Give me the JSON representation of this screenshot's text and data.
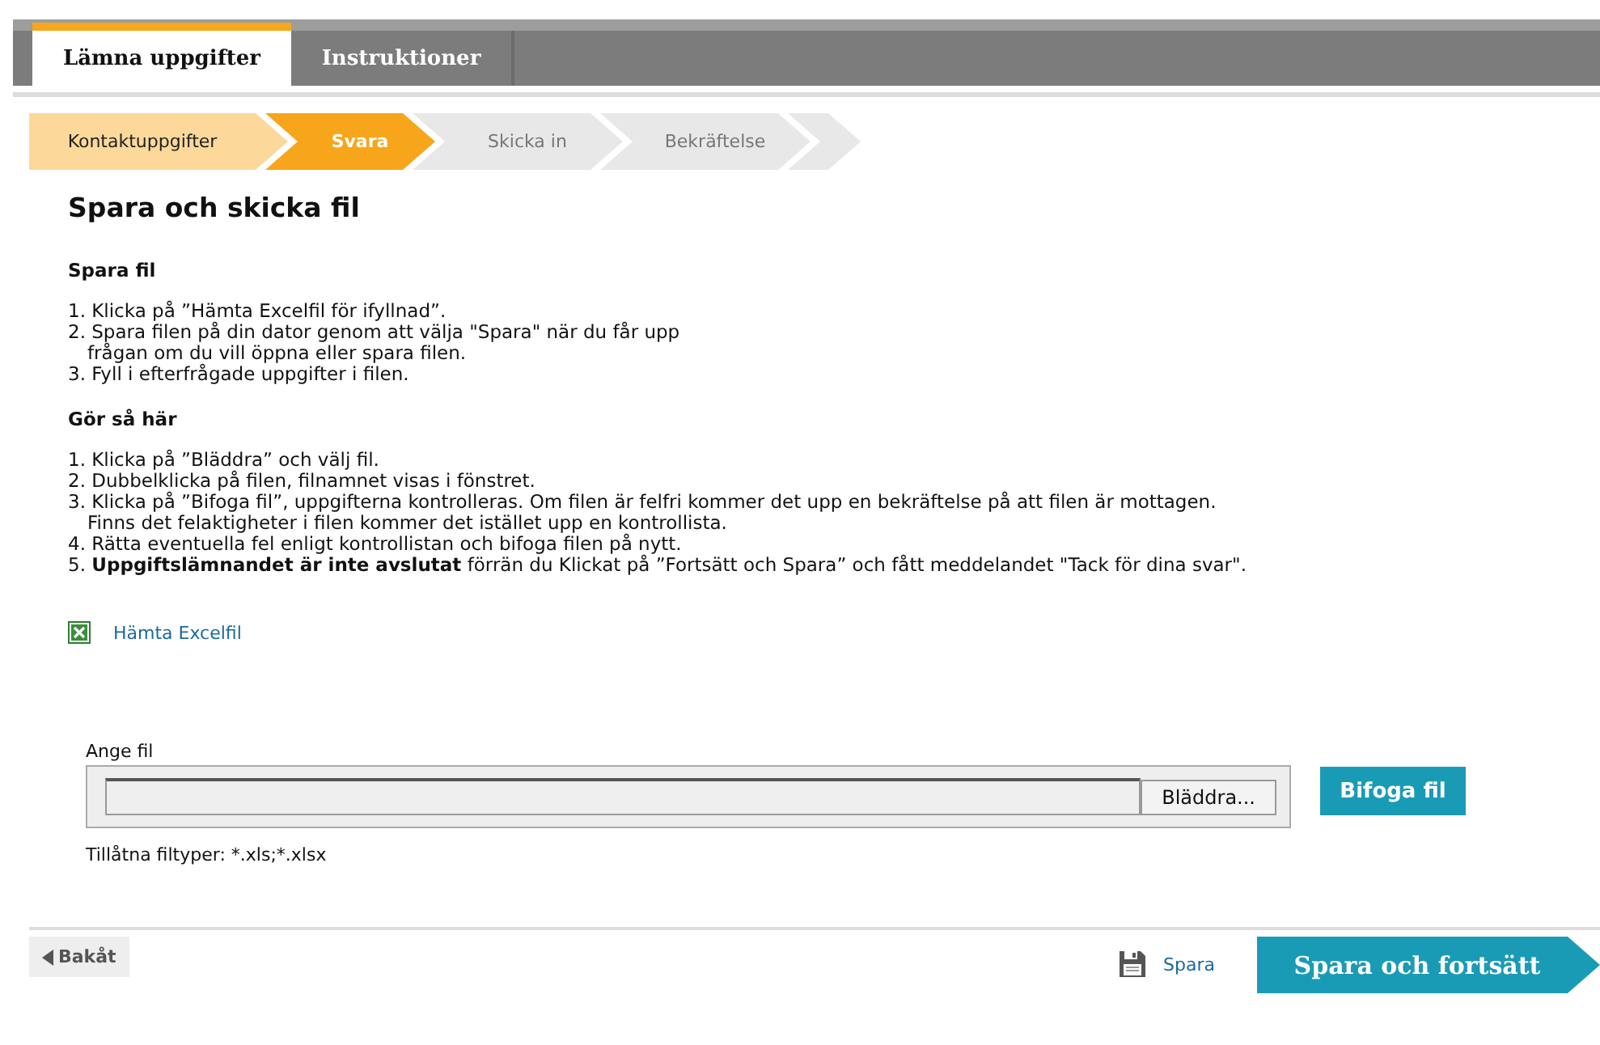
{
  "tabs": [
    {
      "label": "Lämna uppgifter",
      "selected": true
    },
    {
      "label": "Instruktioner",
      "selected": false
    }
  ],
  "steps": [
    {
      "label": "Kontaktuppgifter",
      "selected": false,
      "completed": true
    },
    {
      "label": "Svara",
      "selected": true,
      "completed": false
    },
    {
      "label": "Skicka in",
      "selected": false,
      "completed": false
    },
    {
      "label": "Bekräftelse",
      "selected": false,
      "completed": false
    }
  ],
  "heading": "Spara och skicka fil",
  "sections": [
    {
      "title": "Spara fil",
      "items": [
        {
          "lines": [
            "1. Klicka på ”Hämta Excelfil för ifyllnad”."
          ]
        },
        {
          "lines": [
            "2. Spara filen på din dator genom att välja \"Spara\" när du får upp",
            "frågan om du vill öppna eller spara filen."
          ]
        },
        {
          "lines": [
            "3. Fyll i efterfrågade uppgifter i filen."
          ]
        }
      ]
    },
    {
      "title": "Gör så här",
      "items": [
        {
          "lines": [
            "1. Klicka på ”Bläddra” och välj fil."
          ]
        },
        {
          "lines": [
            "2. Dubbelklicka på filen, filnamnet visas i fönstret."
          ]
        },
        {
          "lines": [
            "3. Klicka på ”Bifoga fil”, uppgifterna kontrolleras. Om filen är felfri kommer det upp en bekräftelse på att filen är mottagen.",
            "Finns det felaktigheter i filen kommer det istället upp en kontrollista."
          ]
        },
        {
          "lines": [
            "4. Rätta eventuella fel enligt kontrollistan och bifoga filen på nytt."
          ]
        },
        {
          "lines": [
            "5. **Uppgiftslämnandet är inte avslutat** förrän du Klickat på ”Fortsätt och Spara” och fått meddelandet \"Tack för dina svar\"."
          ]
        }
      ]
    }
  ],
  "download_link": "Hämta Excelfil",
  "file_field": {
    "label": "Ange fil",
    "browse_button": "Bläddra..."
  },
  "attach_button": "Bifoga fil",
  "allowed_types": "Tillåtna filtyper: *.xls;*.xlsx",
  "footer": {
    "back_button": "Bakåt",
    "save_link": "Spara",
    "continue_button": "Spara och fortsätt"
  }
}
